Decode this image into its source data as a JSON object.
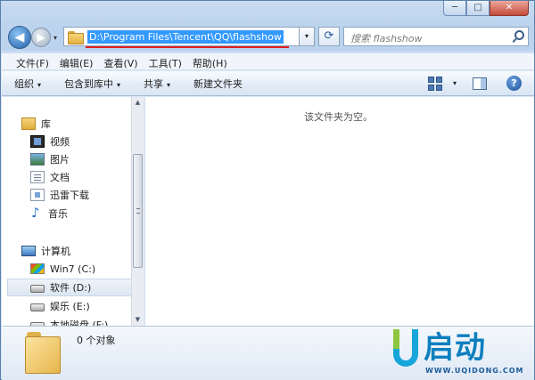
{
  "window": {
    "caption_min": "─",
    "caption_max": "□",
    "caption_close": "✕"
  },
  "nav": {
    "back_glyph": "◀",
    "forward_glyph": "▶",
    "dropdown_glyph": "▾",
    "address_path": "D:\\Program Files\\Tencent\\QQ\\flashshow",
    "refresh_glyph": "⟳",
    "search_placeholder": "搜索 flashshow"
  },
  "menubar": {
    "items": [
      "文件(F)",
      "编辑(E)",
      "查看(V)",
      "工具(T)",
      "帮助(H)"
    ]
  },
  "cmdbar": {
    "organize": "组织",
    "include": "包含到库中",
    "share": "共享",
    "new_folder": "新建文件夹",
    "arrow": "▾",
    "help": "?"
  },
  "tree": {
    "libraries": "库",
    "videos": "视频",
    "pictures": "图片",
    "documents": "文档",
    "xunlei": "迅雷下载",
    "music": "音乐",
    "computer": "计算机",
    "drive_c": "Win7 (C:)",
    "drive_d": "软件 (D:)",
    "drive_e": "娱乐 (E:)",
    "drive_f": "本地磁盘 (F:)"
  },
  "content": {
    "empty_message": "该文件夹为空。"
  },
  "details": {
    "count": "0 个对象"
  },
  "logo": {
    "brand": "启动",
    "url": "WWW.UQIDONG.COM"
  },
  "icons": {
    "search": "search-icon",
    "folder": "folder-icon",
    "help": "help-icon"
  }
}
